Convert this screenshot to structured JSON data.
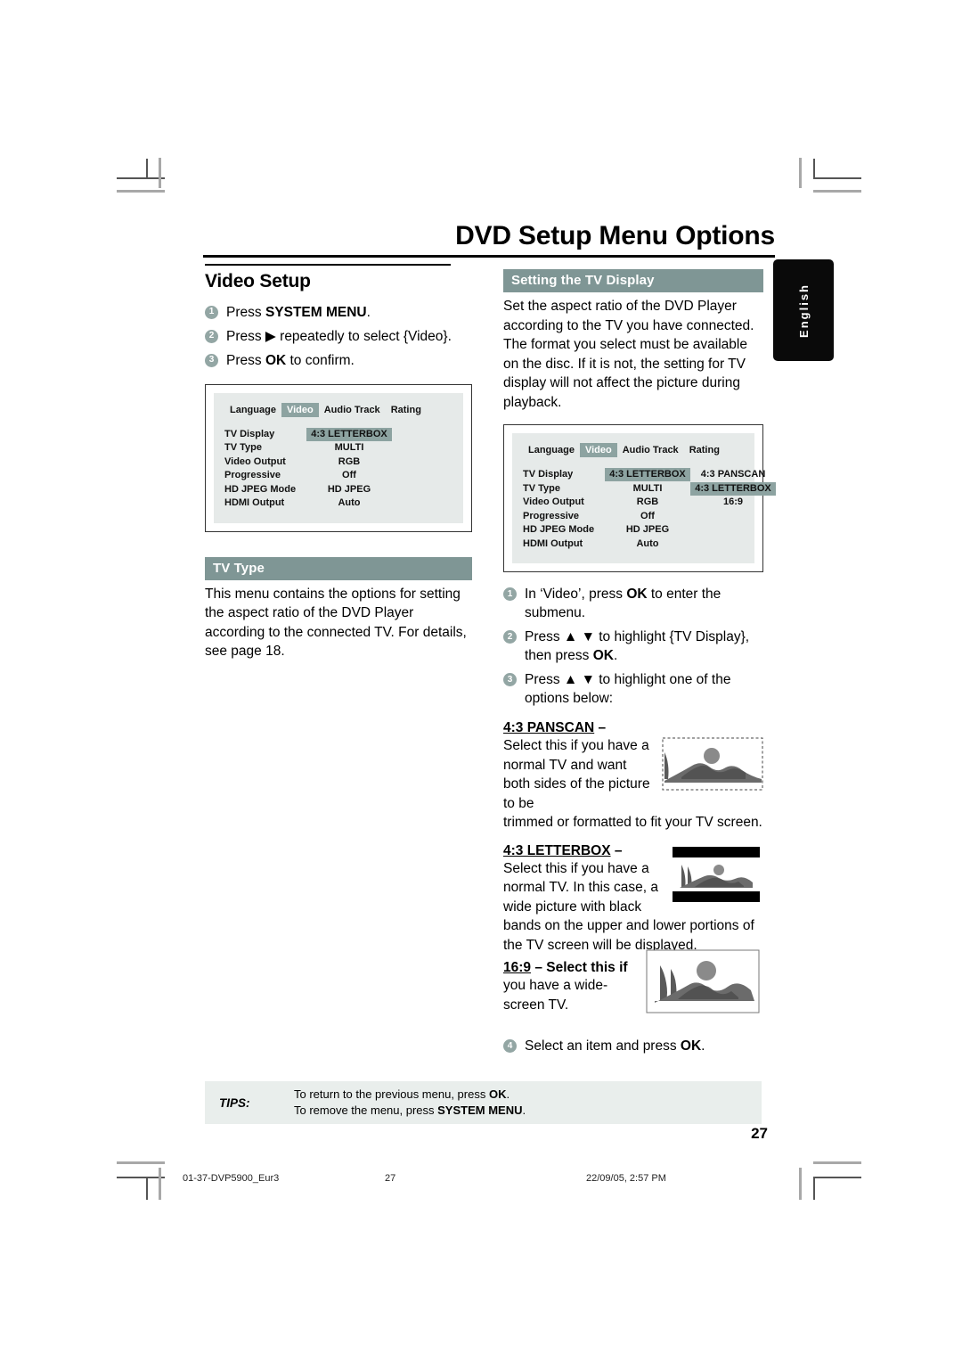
{
  "header": {
    "chapter_title": "DVD Setup Menu Options",
    "language_tab": "English"
  },
  "left_column": {
    "section_title": "Video Setup",
    "steps": [
      {
        "num": "1",
        "html": "Press <b>SYSTEM MENU</b>."
      },
      {
        "num": "2",
        "html": "Press ▶ repeatedly to select {Video}."
      },
      {
        "num": "3",
        "html": "Press <b>OK</b> to confirm."
      }
    ],
    "menu_screenshot": {
      "tabs": [
        {
          "label": "Language",
          "selected": false
        },
        {
          "label": "Video",
          "selected": true
        },
        {
          "label": "Audio Track",
          "selected": false
        },
        {
          "label": "Rating",
          "selected": false
        }
      ],
      "rows": [
        {
          "label": "TV Display",
          "value": "4:3 LETTERBOX",
          "highlight": true
        },
        {
          "label": "TV Type",
          "value": "MULTI",
          "highlight": false
        },
        {
          "label": "Video Output",
          "value": "RGB",
          "highlight": false
        },
        {
          "label": "Progressive",
          "value": "Off",
          "highlight": false
        },
        {
          "label": "HD JPEG Mode",
          "value": "HD JPEG",
          "highlight": false
        },
        {
          "label": "HDMI Output",
          "value": "Auto",
          "highlight": false
        }
      ]
    },
    "tv_type": {
      "bar_title": "TV Type",
      "body": "This menu contains the options for setting the aspect ratio of the DVD Player according to the connected TV. For details, see page 18."
    }
  },
  "right_column": {
    "tv_display": {
      "bar_title": "Setting the TV Display",
      "body": "Set the aspect ratio of the DVD Player according to the TV you have connected. The format you select must be available on the disc.  If it is not, the setting for TV display will not affect the picture during playback."
    },
    "menu_screenshot": {
      "tabs": [
        {
          "label": "Language",
          "selected": false
        },
        {
          "label": "Video",
          "selected": true
        },
        {
          "label": "Audio Track",
          "selected": false
        },
        {
          "label": "Rating",
          "selected": false
        }
      ],
      "rows": [
        {
          "label": "TV Display",
          "value": "4:3 LETTERBOX",
          "highlight": true,
          "option": "4:3 PANSCAN",
          "option_highlight": false
        },
        {
          "label": "TV Type",
          "value": "MULTI",
          "highlight": false,
          "option": "4:3 LETTERBOX",
          "option_highlight": true
        },
        {
          "label": "Video Output",
          "value": "RGB",
          "highlight": false,
          "option": "16:9",
          "option_highlight": false
        },
        {
          "label": "Progressive",
          "value": "Off",
          "highlight": false,
          "option": "",
          "option_highlight": false
        },
        {
          "label": "HD JPEG Mode",
          "value": "HD JPEG",
          "highlight": false,
          "option": "",
          "option_highlight": false
        },
        {
          "label": "HDMI Output",
          "value": "Auto",
          "highlight": false,
          "option": "",
          "option_highlight": false
        }
      ]
    },
    "steps": [
      {
        "num": "1",
        "html": "In ‘Video’, press <b>OK</b> to enter the submenu."
      },
      {
        "num": "2",
        "html": "Press ▲ ▼ to highlight {TV Display}, then press <b>OK</b>."
      },
      {
        "num": "3",
        "html": "Press ▲ ▼ to highlight one of the options below:"
      }
    ],
    "options": [
      {
        "head_html": "<u>4:3 PANSCAN</u> –",
        "narrow_text": "Select this if you have a normal TV and want both sides of the picture to be ",
        "wide_text": "trimmed or formatted to fit your TV screen.",
        "thumb": "panscan-thumbnail"
      },
      {
        "head_html": "<u>4:3 LETTERBOX</u> –",
        "narrow_text": "Select this if you have a normal TV. In this case, a wide picture with black ",
        "wide_text": "bands on the upper and lower portions of the TV screen will be displayed.",
        "thumb": "letterbox-thumbnail"
      },
      {
        "head_html": "<u>16:9</u> – Select this if",
        "narrow_text": "you have a wide-screen TV.",
        "wide_text": "",
        "thumb": "widescreen-thumbnail"
      }
    ],
    "final_step": {
      "num": "4",
      "html": "Select an item and press <b>OK</b>."
    }
  },
  "tips": {
    "label": "TIPS:",
    "line1_html": "To return to the previous menu, press <b>OK</b>.",
    "line2_html": "To remove the menu, press <b>SYSTEM MENU</b>."
  },
  "page_number": "27",
  "footer": {
    "file": "01-37-DVP5900_Eur3",
    "page": "27",
    "timestamp": "22/09/05, 2:57 PM"
  }
}
